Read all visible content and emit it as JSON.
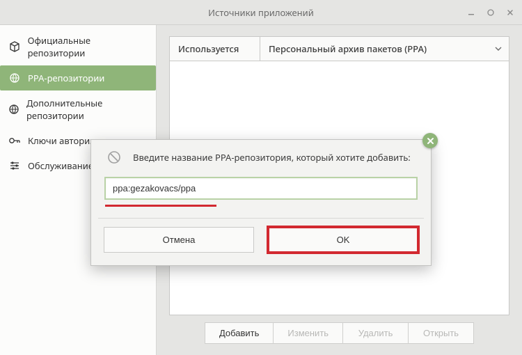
{
  "window": {
    "title": "Источники приложений"
  },
  "sidebar": {
    "items": [
      {
        "label": "Официальные репозитории"
      },
      {
        "label": "PPA-репозитории"
      },
      {
        "label": "Дополнительные репозитории"
      },
      {
        "label": "Ключи авторизации"
      },
      {
        "label": "Обслуживание"
      }
    ],
    "active_index": 1
  },
  "columns": {
    "used": "Используется",
    "name": "Персональный архив пакетов (PPA)"
  },
  "buttons": {
    "add": "Добавить",
    "edit": "Изменить",
    "delete": "Удалить",
    "open": "Открыть"
  },
  "dialog": {
    "message": "Введите название PPA-репозитория, который хотите добавить:",
    "input_value": "ppa:gezakovacs/ppa",
    "cancel": "Отмена",
    "ok": "OK"
  }
}
